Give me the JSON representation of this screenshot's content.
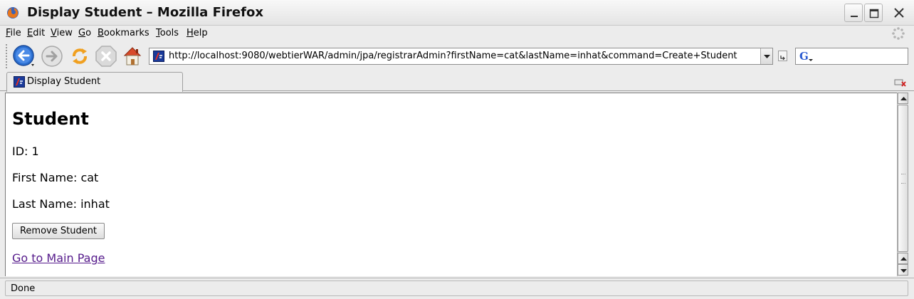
{
  "window": {
    "title": "Display Student – Mozilla Firefox"
  },
  "menu": {
    "items": [
      "File",
      "Edit",
      "View",
      "Go",
      "Bookmarks",
      "Tools",
      "Help"
    ]
  },
  "toolbar": {
    "url": "http://localhost:9080/webtierWAR/admin/jpa/registrarAdmin?firstName=cat&lastName=inhat&command=Create+Student",
    "search_value": ""
  },
  "tabs": [
    {
      "label": "Display Student",
      "active": true
    }
  ],
  "page": {
    "heading": "Student",
    "id_line": "ID: 1",
    "first_name_line": "First Name: cat",
    "last_name_line": "Last Name: inhat",
    "remove_button_label": "Remove Student",
    "main_page_link": "Go to Main Page"
  },
  "status": {
    "text": "Done"
  },
  "colors": {
    "visited_link": "#551a8b",
    "back_button": "#2a6fd1",
    "reload_orange": "#f0a020",
    "home_roof": "#d84a2a"
  },
  "icons": [
    "firefox-icon",
    "minimize-icon",
    "maximize-icon",
    "close-icon",
    "throbber-icon",
    "back-icon",
    "forward-icon",
    "reload-icon",
    "stop-icon",
    "home-icon",
    "site-favicon",
    "go-icon",
    "google-search-icon",
    "tab-close-icon"
  ]
}
